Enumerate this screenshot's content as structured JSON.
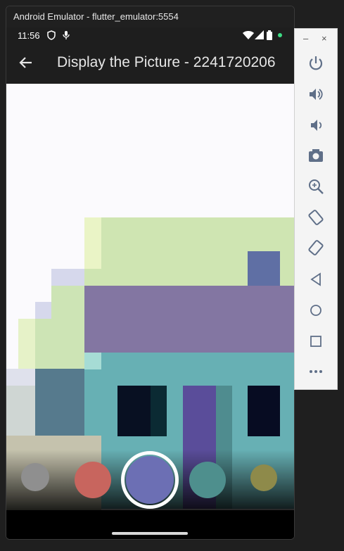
{
  "window": {
    "title": "Android Emulator - flutter_emulator:5554"
  },
  "status_bar": {
    "time": "11:56"
  },
  "app_bar": {
    "title": "Display the Picture - 2241720206"
  },
  "filters": [
    {
      "name": "gray",
      "color": "#8f8f8f"
    },
    {
      "name": "red",
      "color": "#c8655e"
    },
    {
      "name": "blue",
      "color": "#6c6fb4",
      "selected": true
    },
    {
      "name": "teal",
      "color": "#4e8f8d"
    },
    {
      "name": "olive",
      "color": "#8e8a4a"
    }
  ],
  "emulator_controls": [
    {
      "name": "power-icon"
    },
    {
      "name": "volume-up-icon"
    },
    {
      "name": "volume-down-icon"
    },
    {
      "name": "camera-icon"
    },
    {
      "name": "zoom-icon"
    },
    {
      "name": "rotate-left-icon"
    },
    {
      "name": "rotate-right-icon"
    },
    {
      "name": "back-icon"
    },
    {
      "name": "home-icon"
    },
    {
      "name": "overview-icon"
    },
    {
      "name": "more-icon"
    }
  ],
  "side_window_controls": {
    "minimize": "–",
    "close": "×"
  }
}
